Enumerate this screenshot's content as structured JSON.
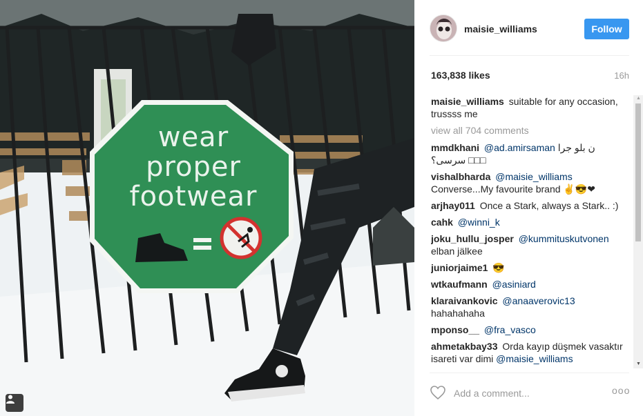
{
  "post": {
    "username": "maisie_williams",
    "follow_label": "Follow",
    "likes": "163,838 likes",
    "time": "16h",
    "caption": "suitable for any occasion, trussss me",
    "view_all": "view all 704 comments",
    "add_comment_placeholder": "Add a comment...",
    "more_label": "ooo"
  },
  "sign": {
    "line1": "wear",
    "line2": "proper",
    "line3": "footwear"
  },
  "comments": [
    {
      "user": "mmdkhani",
      "mention": "@ad.amirsaman",
      "text": "ن بلو جرا سرسی؟ □□□"
    },
    {
      "user": "vishalbharda",
      "mention": "@maisie_williams",
      "text": "Converse...My favourite brand ✌😎❤"
    },
    {
      "user": "arjhay011",
      "mention": "",
      "text": "Once a Stark, always a Stark.. :)"
    },
    {
      "user": "cahk",
      "mention": "@winni_k",
      "text": ""
    },
    {
      "user": "joku_hullu_josper",
      "mention": "@kummituskutvonen",
      "text": "elban jälkee"
    },
    {
      "user": "juniorjaime1",
      "mention": "",
      "text": "😎"
    },
    {
      "user": "wtkaufmann",
      "mention": "@asiniard",
      "text": ""
    },
    {
      "user": "klaraivankovic",
      "mention": "@anaaverovic13",
      "text": "hahahahaha"
    },
    {
      "user": "mponso__",
      "mention": "@fra_vasco",
      "text": ""
    },
    {
      "user": "ahmetakbay33",
      "mention": "",
      "text": "Orda kayıp düşmek vasaktır isareti var dimi",
      "trailing_mention": "@maisie_williams"
    }
  ],
  "colors": {
    "follow_bg": "#3897f0",
    "mention": "#003569",
    "sign_green": "#2f8f55",
    "muted": "#999999"
  }
}
